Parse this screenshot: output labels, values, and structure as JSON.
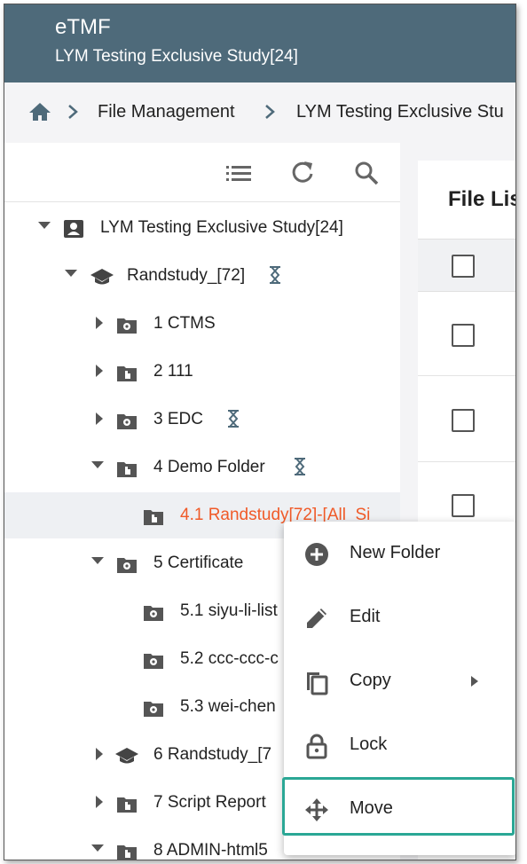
{
  "app": {
    "title": "eTMF",
    "study": "LYM Testing Exclusive Study[24]"
  },
  "breadcrumb": {
    "items": [
      "File Management",
      "LYM Testing Exclusive Stu"
    ]
  },
  "tree_toolbar": {
    "icons": [
      "list-icon",
      "refresh-icon",
      "search-icon"
    ]
  },
  "tree": {
    "root": "LYM Testing Exclusive Study[24]",
    "study": "Randstudy_[72]",
    "items": [
      {
        "label": "1  CTMS"
      },
      {
        "label": "2  111"
      },
      {
        "label": "3  EDC"
      },
      {
        "label": "4  Demo Folder"
      },
      {
        "label": "4.1  Randstudy[72]-[All_Si"
      },
      {
        "label": "5  Certificate"
      },
      {
        "label": "5.1  siyu-li-list"
      },
      {
        "label": "5.2  ccc-ccc-c"
      },
      {
        "label": "5.3  wei-chen"
      },
      {
        "label": "6  Randstudy_[7"
      },
      {
        "label": "7  Script Report"
      },
      {
        "label": "8  ADMIN-html5"
      }
    ]
  },
  "file_list": {
    "title": "File Lis"
  },
  "context_menu": {
    "items": [
      {
        "label": "New Folder",
        "icon": "add-circle-icon"
      },
      {
        "label": "Edit",
        "icon": "pencil-icon"
      },
      {
        "label": "Copy",
        "icon": "copy-icon"
      },
      {
        "label": "Lock",
        "icon": "lock-icon"
      },
      {
        "label": "Move",
        "icon": "move-icon"
      }
    ]
  },
  "colors": {
    "header": "#4e6a7a",
    "selected_text": "#f05a28",
    "highlight": "#2aa795"
  }
}
